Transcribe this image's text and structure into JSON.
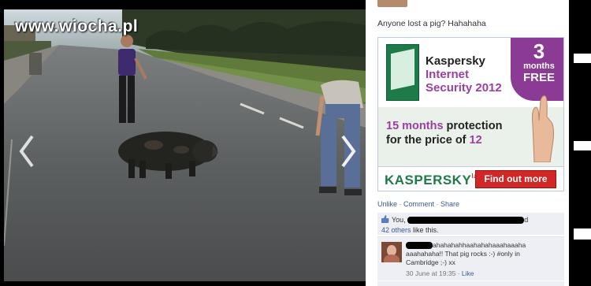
{
  "photo": {
    "watermark": "www.wiocha.pl",
    "prev_arrow": "chevron-left-icon",
    "next_arrow": "chevron-right-icon"
  },
  "caption": "Anyone lost a pig? Hahahaha",
  "ad": {
    "brand_line1": "Kaspersky",
    "brand_line2": "Internet",
    "brand_line3": "Security 2012",
    "badge_number": "3",
    "badge_text": "months",
    "badge_free": "FREE",
    "promo_line1_highlight": "15 months",
    "promo_line1_rest": " protection",
    "promo_line2_start": "for the price of ",
    "promo_line2_highlight": "12",
    "logo_text": "KASPERSKY",
    "logo_lab": "lab",
    "cta_label": "Find out more",
    "adchoices_icon": "ad-choices-icon"
  },
  "actions": {
    "unlike": "Unlike",
    "comment": "Comment",
    "share": "Share",
    "separator": " · "
  },
  "likes": {
    "prefix": "You,",
    "suffix": "d",
    "others_link": "42 others",
    "others_rest": " like this."
  },
  "comment": {
    "line1": "ahahahahhaahahahaaahaaaha",
    "line2": "aaahahaha!! That pig rocks :-) #only in",
    "line3": "Cambridge ;-) xx",
    "timestamp": "30 June at 19:35",
    "like_link": "Like",
    "sep": " · "
  },
  "colors": {
    "fb_blue": "#3b5998",
    "kaspersky_green": "#1e7a49",
    "kaspersky_purple": "#9b3fa2",
    "cta_red": "#d12727"
  }
}
